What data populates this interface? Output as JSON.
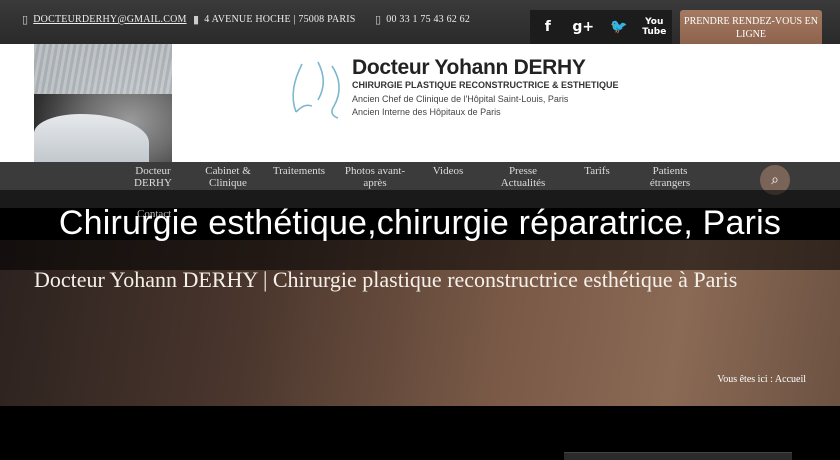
{
  "topbar": {
    "email": "DOCTEURDERHY@GMAIL.COM",
    "address": "4 AVENUE HOCHE | 75008 PARIS",
    "phone": "00 33 1 75 43 62 62",
    "email_icon": "mobile-icon",
    "address_icon": "map-pin-icon",
    "phone_icon": "phone-icon",
    "social": [
      {
        "name": "facebook-icon",
        "glyph": "f"
      },
      {
        "name": "google-plus-icon",
        "glyph": "g+"
      },
      {
        "name": "twitter-icon",
        "glyph": "🐦"
      },
      {
        "name": "youtube-icon",
        "glyph": "You"
      }
    ],
    "appointment_label": "PRENDRE RENDEZ-VOUS EN LIGNE"
  },
  "logo": {
    "name": "Docteur Yohann DERHY",
    "subtitle": "CHIRURGIE PLASTIQUE RECONSTRUCTRICE & ESTHETIQUE",
    "line1": "Ancien Chef de Clinique de l'Hôpital Saint-Louis, Paris",
    "line2": "Ancien Interne des Hôpitaux de Paris"
  },
  "nav": {
    "items": [
      {
        "label": "Docteur\nDERHY"
      },
      {
        "label": "Cabinet &\nClinique"
      },
      {
        "label": "Traitements"
      },
      {
        "label": "Photos avant-\naprès"
      },
      {
        "label": "Videos"
      },
      {
        "label": "Presse\nActualités"
      },
      {
        "label": "Tarifs"
      },
      {
        "label": "Patients\nétrangers"
      }
    ],
    "contact": "Contact",
    "search_icon": "search-icon"
  },
  "overlay_title": "Chirurgie esthétique,chirurgie réparatrice, Paris",
  "hero": {
    "heading": "Docteur Yohann DERHY | Chirurgie plastique reconstructrice esthétique à Paris",
    "breadcrumb_prefix": "Vous êtes ici :",
    "breadcrumb_current": "Accueil"
  },
  "colors": {
    "topbar": "#2f2f2f",
    "appointment": "#9a6f58",
    "nav": "#3b3b3b",
    "search": "#7a6457"
  }
}
